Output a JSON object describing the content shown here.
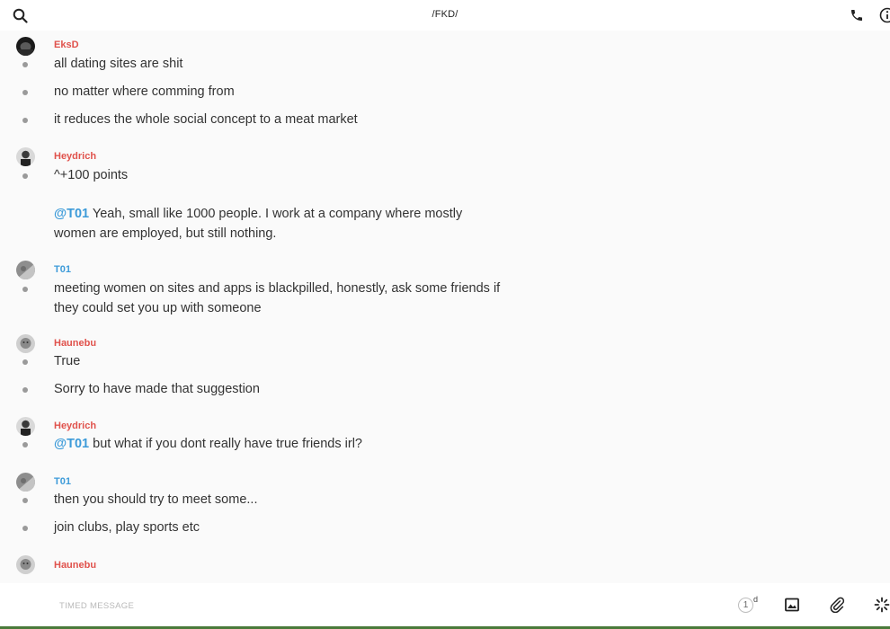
{
  "header": {
    "title": "/FKD/",
    "search_icon": "search-icon",
    "phone_icon": "phone-icon",
    "info_icon": "info-icon"
  },
  "colors": {
    "author_red": "#e0524c",
    "author_blue": "#3d9bd9",
    "mention": "#3d9bd9"
  },
  "messages": [
    {
      "author": "EksD",
      "author_color": "#e0524c",
      "lines": [
        "all dating sites are shit",
        "no matter where comming from",
        "it reduces the whole social concept to a meat market"
      ]
    },
    {
      "author": "Heydrich",
      "author_color": "#e0524c",
      "lines": [
        "^+100 points"
      ],
      "reply": {
        "mention": "@T01",
        "text": " Yeah, small like 1000 people. I work at a company where mostly women are employed, but still nothing."
      }
    },
    {
      "author": "T01",
      "author_color": "#3d9bd9",
      "lines": [
        "meeting women on sites and apps is blackpilled, honestly, ask some friends if they could set you up with someone"
      ]
    },
    {
      "author": "Haunebu",
      "author_color": "#e0524c",
      "lines": [
        "True",
        "Sorry to have made that suggestion"
      ]
    },
    {
      "author": "Heydrich",
      "author_color": "#e0524c",
      "mention_line": {
        "mention": "@T01",
        "text": " but what if you dont really have true friends irl?"
      }
    },
    {
      "author": "T01",
      "author_color": "#3d9bd9",
      "lines": [
        "then you should try to meet some...",
        "join clubs, play sports etc"
      ]
    },
    {
      "author": "Haunebu",
      "author_color": "#e0524c",
      "lines": []
    }
  ],
  "composer": {
    "placeholder": "TIMED MESSAGE",
    "timer_value": "1",
    "timer_unit": "d",
    "image_icon": "image-icon",
    "attach_icon": "paperclip-icon",
    "ephemeral_icon": "spinner-icon"
  }
}
